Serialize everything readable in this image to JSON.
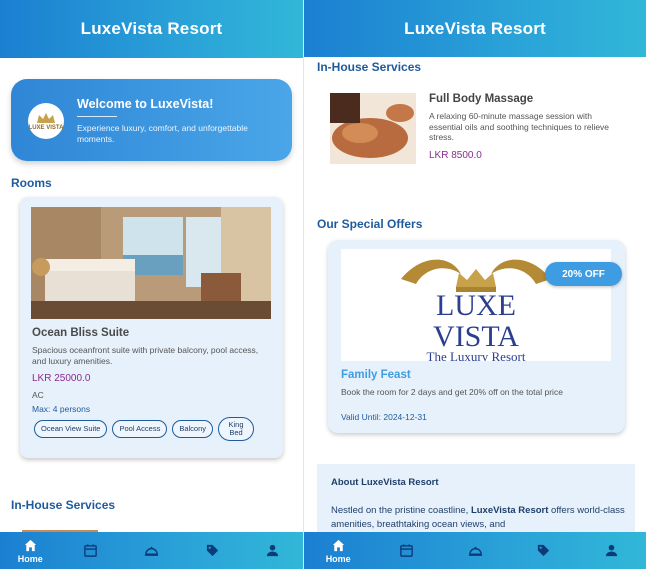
{
  "app": {
    "title": "LuxeVista Resort"
  },
  "welcome": {
    "logo_text": "LUXE VISTA",
    "title": "Welcome to LuxeVista!",
    "text": "Experience luxury, comfort, and unforgettable moments."
  },
  "sections": {
    "rooms": "Rooms",
    "in_house": "In-House Services",
    "offers": "Our Special Offers"
  },
  "room": {
    "name": "Ocean Bliss Suite",
    "description": "Spacious oceanfront suite with private balcony, pool access, and luxury amenities.",
    "price": "LKR 25000.0",
    "type": "AC",
    "max": "Max: 4 persons",
    "features": [
      "Ocean View Suite",
      "Pool Access",
      "Balcony",
      "King Bed"
    ]
  },
  "service": {
    "name": "Full Body Massage",
    "description": "A relaxing 60-minute massage session with essential oils and soothing techniques to relieve stress.",
    "price": "LKR 8500.0"
  },
  "offer": {
    "badge": "20% OFF",
    "logo_line1": "LUXE",
    "logo_line2": "VISTA",
    "logo_tagline": "The Luxury Resort",
    "title": "Family Feast",
    "description": "Book the room for 2 days and get 20% off on the total price",
    "valid": "Valid Until: 2024-12-31"
  },
  "about": {
    "title": "About LuxeVista Resort",
    "text_before": "Nestled on the pristine coastline, ",
    "text_bold": "LuxeVista Resort",
    "text_after": " offers world-class amenities, breathtaking ocean views, and"
  },
  "nav": {
    "home_label": "Home",
    "items": [
      "home-icon",
      "calendar-icon",
      "service-bell-icon",
      "tag-icon",
      "profile-icon"
    ]
  },
  "colors": {
    "bar_start": "#1b7fd1",
    "bar_end": "#31b7d8",
    "section_title": "#1f5b9c",
    "price": "#8b2a8f",
    "offer_accent": "#3e9de2"
  }
}
